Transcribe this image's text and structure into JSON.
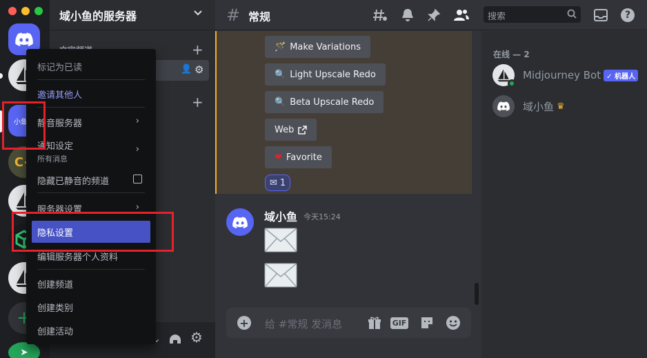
{
  "guild": {
    "name": "域小鱼的服务器"
  },
  "sidebar": {
    "category_label": "文字频道",
    "selected_server_label": "小鱼的"
  },
  "channel": {
    "name": "常规"
  },
  "header": {
    "search_placeholder": "搜索"
  },
  "messages": {
    "buttons": [
      "Make Variations",
      "Light Upscale Redo",
      "Beta Upscale Redo",
      "Web",
      "Favorite"
    ],
    "reaction": {
      "emoji": "envelope-icon",
      "count": "1"
    },
    "author": "域小鱼",
    "timestamp": "今天15:24"
  },
  "composer": {
    "placeholder": "给 #常规 发消息",
    "gif_label": "GIF"
  },
  "members": {
    "section_title": "在线 — 2",
    "list": [
      {
        "name": "Midjourney Bot",
        "tag": "✓ 机器人"
      },
      {
        "name": "域小鱼"
      }
    ]
  },
  "context_menu": {
    "mark_read": "标记为已读",
    "invite": "邀请其他人",
    "mute": "静音服务器",
    "notify": "通知设定",
    "notify_sub": "所有消息",
    "hide_muted": "隐藏已静音的频道",
    "server_settings": "服务器设置",
    "privacy": "隐私设置",
    "edit_profile": "编辑服务器个人资料",
    "create_channel": "创建频道",
    "create_category": "创建类别",
    "create_event": "创建活动"
  },
  "colors": {
    "accent": "#5865f2",
    "highlight_bar": "#f0b232",
    "annotation_red": "#e5212a"
  }
}
